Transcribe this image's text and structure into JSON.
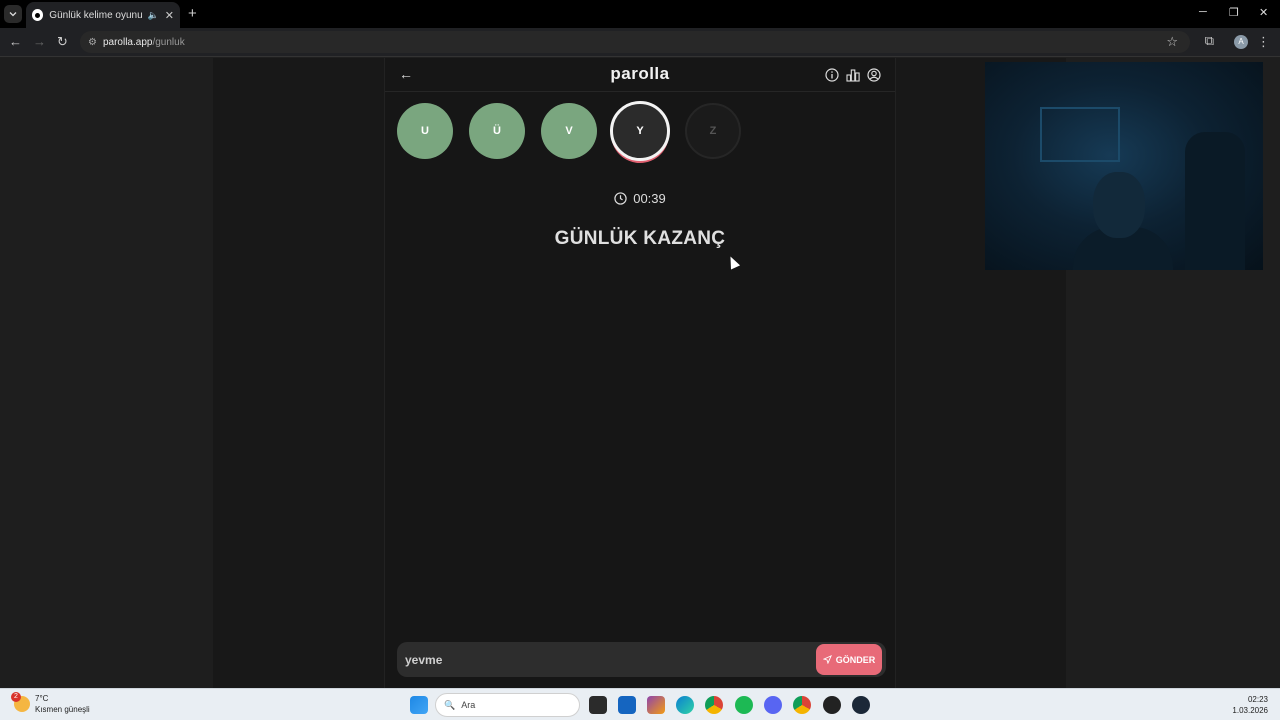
{
  "browser": {
    "tab_title": "Günlük kelime oyunu - parolla",
    "url_host": "parolla.app",
    "url_path": "/gunluk",
    "profile_initial": "A"
  },
  "app": {
    "logo": "parolla",
    "letters": [
      {
        "letter": "U",
        "state": "done"
      },
      {
        "letter": "Ü",
        "state": "done"
      },
      {
        "letter": "V",
        "state": "done"
      },
      {
        "letter": "Y",
        "state": "current"
      },
      {
        "letter": "Z",
        "state": "pending"
      }
    ],
    "timer": "00:39",
    "question": "GÜNLÜK KAZANÇ",
    "answer_value": "yevme",
    "send_label": "GÖNDER"
  },
  "taskbar": {
    "weather_temp": "7°C",
    "weather_desc": "Kısmen güneşli",
    "weather_badge": "2",
    "search_placeholder": "Ara",
    "time": "02:23",
    "date": "1.03.2026"
  },
  "colors": {
    "done": "#7aa67f",
    "accent": "#e86a78",
    "background": "#161616"
  }
}
